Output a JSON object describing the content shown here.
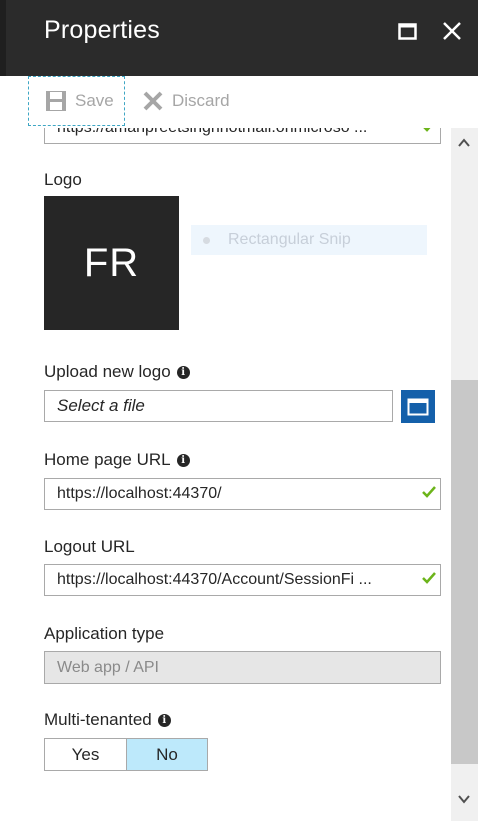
{
  "header": {
    "title": "Properties"
  },
  "toolbar": {
    "save_label": "Save",
    "discard_label": "Discard"
  },
  "form": {
    "partial_url_value": "https://amanpreetsinghhotmail.onmicroso ...",
    "logo_label": "Logo",
    "logo_initials": "FR",
    "snip_overlay_text": "Rectangular Snip",
    "upload_label": "Upload new logo",
    "upload_placeholder": "Select a file",
    "home_page_label": "Home page URL",
    "home_page_value": "https://localhost:44370/",
    "logout_label": "Logout URL",
    "logout_value": "https://localhost:44370/Account/SessionFi ...",
    "app_type_label": "Application type",
    "app_type_value": "Web app / API",
    "multi_tenanted_label": "Multi-tenanted",
    "multi_tenanted_options": [
      "Yes",
      "No"
    ],
    "multi_tenanted_selected": "No"
  },
  "colors": {
    "header_bg": "#2b2b2b",
    "accent_blue": "#1460aa",
    "selected_toggle": "#bde9fb",
    "valid_check": "#6cb41a"
  },
  "icons": {
    "save": "save-icon",
    "discard": "close-x-icon",
    "info": "info-icon",
    "folder": "folder-icon",
    "check": "checkmark-icon"
  }
}
